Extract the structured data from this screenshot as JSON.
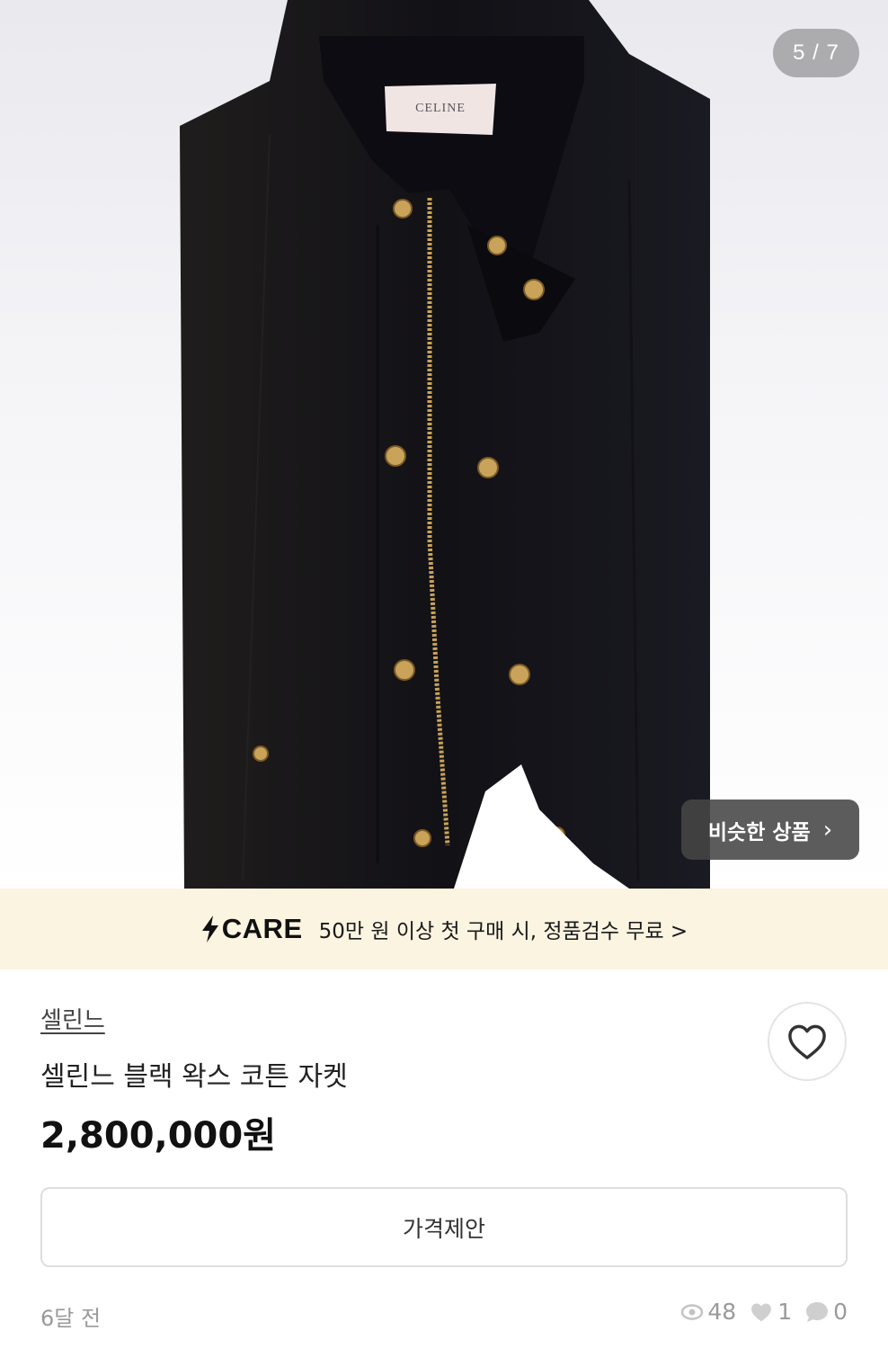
{
  "gallery": {
    "counter": "5 / 7",
    "label_text": "CELINE",
    "similar_button": "비슷한 상품",
    "similar_chevron": "›"
  },
  "care_banner": {
    "logo": "CARE",
    "text": "50만 원 이상 첫 구매 시, 정품검수 무료 >"
  },
  "product": {
    "brand": "셀린느",
    "title": "셀린느 블랙 왁스 코튼 자켓",
    "price": "2,800,000원",
    "offer_button": "가격제안"
  },
  "meta": {
    "posted": "6달 전",
    "views": "48",
    "likes": "1",
    "chats": "0"
  },
  "colors": {
    "banner_bg": "#fbf4e1",
    "jacket": "#16161a",
    "hardware_gold": "#c9a35a",
    "muted_text": "#9a9a9a"
  },
  "icons": [
    "heart-icon",
    "eye-icon",
    "heart-small-icon",
    "chat-bubble-icon",
    "lightning-icon",
    "chevron-right-icon"
  ]
}
